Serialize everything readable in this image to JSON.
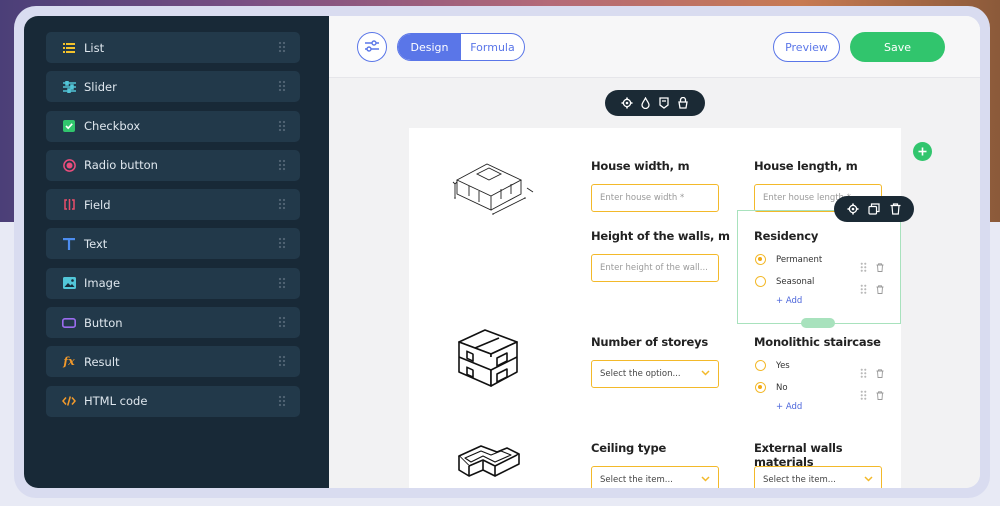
{
  "sidebar": {
    "items": [
      {
        "label": "List",
        "icon": "list-icon",
        "color": "#f3c22b"
      },
      {
        "label": "Slider",
        "icon": "slider-icon",
        "color": "#52c6d8"
      },
      {
        "label": "Checkbox",
        "icon": "checkbox-icon",
        "color": "#31c56d"
      },
      {
        "label": "Radio button",
        "icon": "radio-icon",
        "color": "#e94d7c"
      },
      {
        "label": "Field",
        "icon": "field-icon",
        "color": "#e94d6a"
      },
      {
        "label": "Text",
        "icon": "text-icon",
        "color": "#4d8df0"
      },
      {
        "label": "Image",
        "icon": "image-icon",
        "color": "#52c6d8"
      },
      {
        "label": "Button",
        "icon": "button-icon",
        "color": "#9b6cf0"
      },
      {
        "label": "Result",
        "icon": "function-icon",
        "color": "#f39a2b"
      },
      {
        "label": "HTML code",
        "icon": "code-icon",
        "color": "#f39a2b"
      }
    ]
  },
  "topbar": {
    "tabs": [
      "Design",
      "Formula"
    ],
    "active_tab": "Design",
    "preview_label": "Preview",
    "save_label": "Save"
  },
  "form": {
    "house_width": {
      "label": "House width, m",
      "placeholder": "Enter house width *"
    },
    "house_length": {
      "label": "House length, m",
      "placeholder": "Enter house length *"
    },
    "wall_height": {
      "label": "Height of the walls, m",
      "placeholder": "Enter height of the wall..."
    },
    "residency": {
      "label": "Residency",
      "options": [
        {
          "label": "Permanent",
          "selected": true
        },
        {
          "label": "Seasonal",
          "selected": false
        }
      ],
      "add_label": "+ Add"
    },
    "storeys": {
      "label": "Number of storeys",
      "value": "Select the option..."
    },
    "staircase": {
      "label": "Monolithic staircase",
      "options": [
        {
          "label": "Yes",
          "selected": false
        },
        {
          "label": "No",
          "selected": true
        }
      ],
      "add_label": "+ Add"
    },
    "ceiling": {
      "label": "Ceiling type",
      "value": "Select the item..."
    },
    "walls_material": {
      "label": "External walls materials",
      "value": "Select the item..."
    }
  },
  "colors": {
    "accent": "#5a76e8",
    "save": "#31c56d",
    "field_border": "#f3b92a",
    "sidebar_bg": "#182937"
  }
}
